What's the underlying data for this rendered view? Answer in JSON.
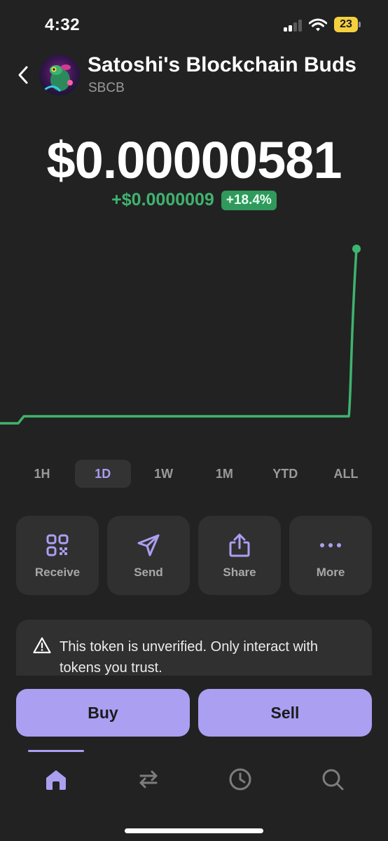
{
  "status_bar": {
    "time": "4:32",
    "battery": "23"
  },
  "header": {
    "title": "Satoshi's Blockchain Buds",
    "symbol": "SBCB",
    "avatar_icon": "token-avatar-icon"
  },
  "price": {
    "value": "$0.00000581",
    "change_abs": "+$0.0000009",
    "change_pct": "+18.4%",
    "positive_color": "#3fb36f"
  },
  "chart_data": {
    "type": "line",
    "series": [
      {
        "values_fraction": [
          0.0,
          0.0,
          0.04,
          0.04,
          0.04,
          0.04,
          0.04,
          0.04,
          0.04,
          0.04,
          0.04,
          1.0
        ]
      }
    ],
    "color": "#3fb36f",
    "grid": false
  },
  "ranges": [
    {
      "label": "1H",
      "active": false
    },
    {
      "label": "1D",
      "active": true
    },
    {
      "label": "1W",
      "active": false
    },
    {
      "label": "1M",
      "active": false
    },
    {
      "label": "YTD",
      "active": false
    },
    {
      "label": "ALL",
      "active": false
    }
  ],
  "actions": [
    {
      "label": "Receive",
      "icon": "qr-code-icon"
    },
    {
      "label": "Send",
      "icon": "paper-plane-icon"
    },
    {
      "label": "Share",
      "icon": "share-icon"
    },
    {
      "label": "More",
      "icon": "more-dots-icon"
    }
  ],
  "warning": {
    "text": "This token is unverified. Only interact with tokens you trust.",
    "icon": "warning-triangle-icon"
  },
  "trade": {
    "buy_label": "Buy",
    "sell_label": "Sell"
  },
  "tabs": [
    {
      "name": "home",
      "icon": "home-icon",
      "active": true
    },
    {
      "name": "swap",
      "icon": "swap-icon",
      "active": false
    },
    {
      "name": "activity",
      "icon": "clock-icon",
      "active": false
    },
    {
      "name": "search",
      "icon": "search-icon",
      "active": false
    }
  ],
  "colors": {
    "accent": "#ab9ff2",
    "background": "#222222",
    "card": "#303030"
  }
}
